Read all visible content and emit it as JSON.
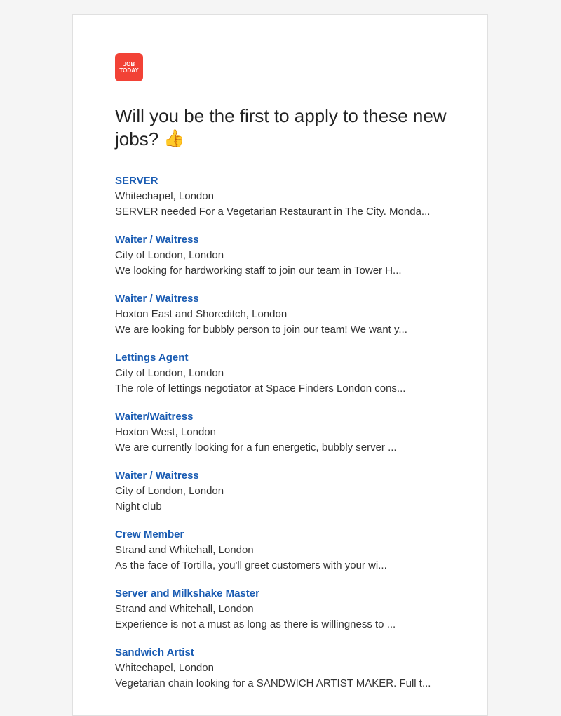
{
  "brand": {
    "logo_line1": "JOB",
    "logo_line2": "TODAY",
    "color": "#f24236"
  },
  "headline": {
    "text": "Will you be the first to apply to these new jobs?",
    "emoji": "👍"
  },
  "jobs": [
    {
      "title": "SERVER",
      "location": "Whitechapel, London",
      "description": "SERVER needed For a Vegetarian Restaurant in The City. Monda..."
    },
    {
      "title": "Waiter / Waitress",
      "location": "City of London, London",
      "description": "We looking for hardworking staff to join our team in Tower H..."
    },
    {
      "title": "Waiter / Waitress",
      "location": "Hoxton East and Shoreditch, London",
      "description": "We are looking for bubbly person to join our team! We want y..."
    },
    {
      "title": "Lettings Agent",
      "location": "City of London, London",
      "description": "The role of lettings negotiator at Space Finders London cons..."
    },
    {
      "title": "Waiter/Waitress",
      "location": "Hoxton West, London",
      "description": "We are currently looking for a fun energetic, bubbly server ..."
    },
    {
      "title": "Waiter / Waitress",
      "location": "City of London, London",
      "description": "Night club"
    },
    {
      "title": "Crew Member",
      "location": "Strand and Whitehall, London",
      "description": "As the face of Tortilla, you'll greet customers with your wi..."
    },
    {
      "title": "Server and Milkshake Master",
      "location": "Strand and Whitehall, London",
      "description": "Experience is not a must as long as there is willingness to ..."
    },
    {
      "title": "Sandwich Artist",
      "location": "Whitechapel, London",
      "description": "Vegetarian chain looking for a SANDWICH ARTIST MAKER. Full t..."
    }
  ],
  "colors": {
    "link": "#1a5cb3",
    "text": "#333333",
    "background": "#f5f5f5"
  }
}
